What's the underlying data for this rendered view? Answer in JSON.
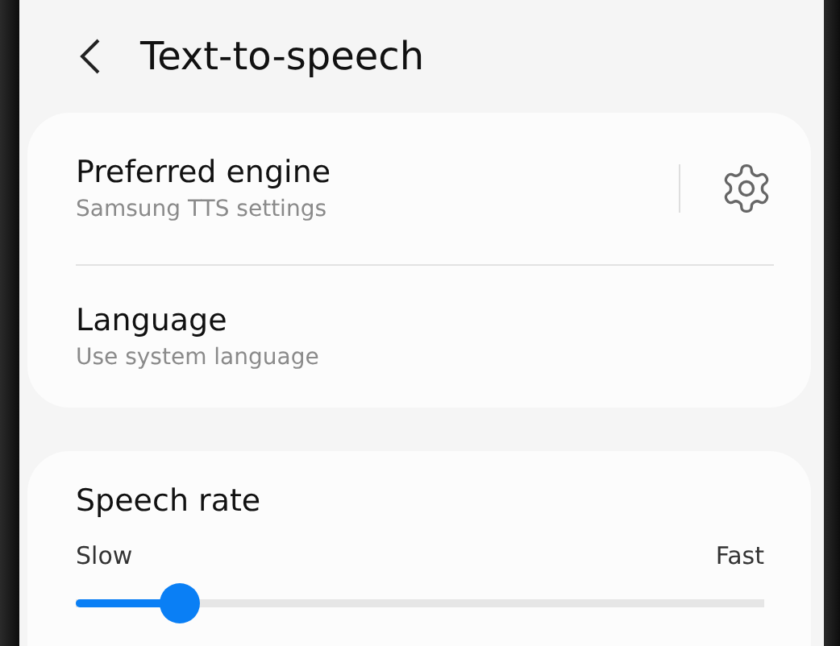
{
  "header": {
    "title": "Text-to-speech"
  },
  "settings": [
    {
      "kind": "with_settings",
      "title": "Preferred engine",
      "subtitle": "Samsung TTS settings"
    },
    {
      "kind": "plain",
      "title": "Language",
      "subtitle": "Use system language"
    }
  ],
  "speech_rate": {
    "title": "Speech rate",
    "min_label": "Slow",
    "max_label": "Fast",
    "level": 0.15
  }
}
